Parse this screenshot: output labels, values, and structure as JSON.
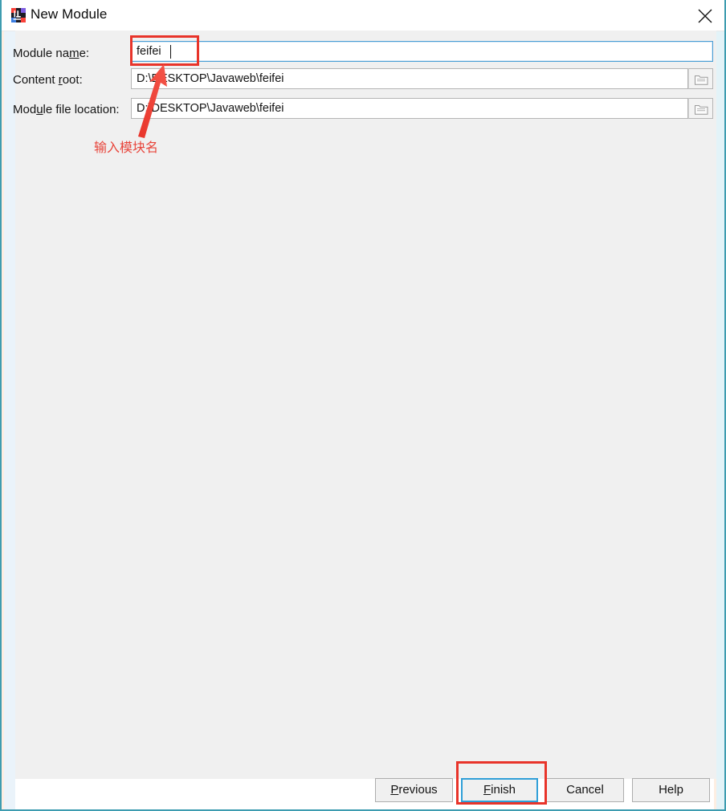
{
  "window": {
    "title": "New Module",
    "icon": "intellij-idea-icon",
    "close_label": "✕",
    "border_color": "#3e9cb0"
  },
  "form": {
    "fields": [
      {
        "label_pre": "Module na",
        "label_mnemonic": "m",
        "label_post": "e:",
        "label_full": "Module name:",
        "value": "feifei",
        "placeholder": "",
        "focused": true,
        "has_browse": false
      },
      {
        "label_pre": "Content ",
        "label_mnemonic": "r",
        "label_post": "oot:",
        "label_full": "Content root:",
        "value": "D:\\DESKTOP\\Javaweb\\feifei",
        "placeholder": "",
        "focused": false,
        "has_browse": true,
        "browse_icon": "folder-icon"
      },
      {
        "label_pre": "Mod",
        "label_mnemonic": "u",
        "label_post": "le file location:",
        "label_full": "Module file location:",
        "value": "D:\\DESKTOP\\Javaweb\\feifei",
        "placeholder": "",
        "focused": false,
        "has_browse": true,
        "browse_icon": "folder-icon"
      }
    ]
  },
  "buttons": [
    {
      "name": "previous",
      "pre": "",
      "mnemonic": "P",
      "post": "revious",
      "label_full": "Previous",
      "default": false
    },
    {
      "name": "finish",
      "pre": "",
      "mnemonic": "F",
      "post": "inish",
      "label_full": "Finish",
      "default": true
    },
    {
      "name": "cancel",
      "pre": "Cancel",
      "mnemonic": "",
      "post": "",
      "label_full": "Cancel",
      "default": false
    },
    {
      "name": "help",
      "pre": "Help",
      "mnemonic": "",
      "post": "",
      "label_full": "Help",
      "default": false
    }
  ],
  "annotations": {
    "color": "#e8342a",
    "note_text": "输入模块名",
    "highlight_targets": [
      "module-name-input",
      "finish-button"
    ]
  }
}
